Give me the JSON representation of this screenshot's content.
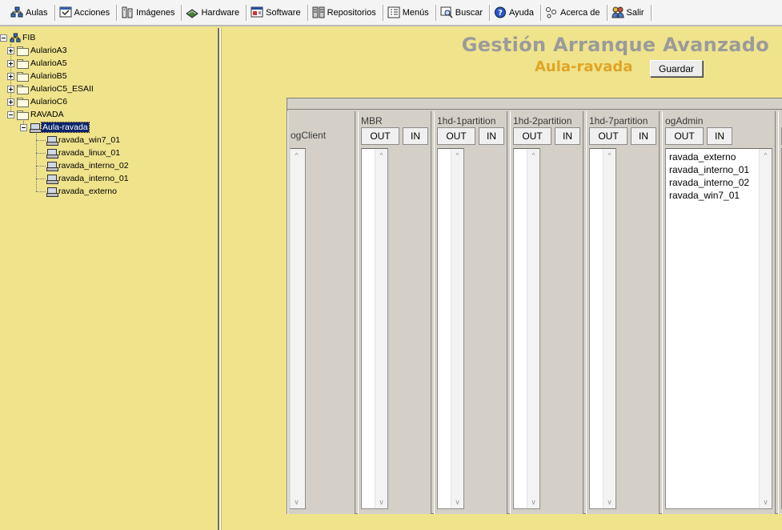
{
  "toolbar": {
    "items": [
      {
        "label": "Aulas",
        "icon": "network-icon"
      },
      {
        "label": "Acciones",
        "icon": "actions-icon"
      },
      {
        "label": "Imágenes",
        "icon": "images-icon"
      },
      {
        "label": "Hardware",
        "icon": "hardware-icon"
      },
      {
        "label": "Software",
        "icon": "software-icon"
      },
      {
        "label": "Repositorios",
        "icon": "repository-icon"
      },
      {
        "label": "Menús",
        "icon": "menu-icon"
      },
      {
        "label": "Buscar",
        "icon": "search-icon"
      },
      {
        "label": "Ayuda",
        "icon": "help-icon"
      },
      {
        "label": "Acerca de",
        "icon": "about-icon"
      },
      {
        "label": "Salir",
        "icon": "exit-icon"
      }
    ]
  },
  "tree": {
    "root": "FIB",
    "groups": [
      "AularioA3",
      "AularioA5",
      "AularioB5",
      "AularioC5_ESAII",
      "AularioC6",
      "RAVADA"
    ],
    "selected_aula": "Aula-ravada",
    "computers": [
      "ravada_win7_01",
      "ravada_linux_01",
      "ravada_interno_02",
      "ravada_interno_01",
      "ravada_externo"
    ]
  },
  "main": {
    "title": "Gestión Arranque Avanzado",
    "subtitle": "Aula-ravada",
    "save_label": "Guardar"
  },
  "columns": {
    "ogclient": {
      "title": "ogClient"
    },
    "mbr": {
      "title": "MBR",
      "out": "OUT",
      "in": "IN"
    },
    "p1": {
      "title": "1hd-1partition",
      "out": "OUT",
      "in": "IN"
    },
    "p2": {
      "title": "1hd-2partition",
      "out": "OUT",
      "in": "IN"
    },
    "p7": {
      "title": "1hd-7partition",
      "out": "OUT",
      "in": "IN"
    },
    "ogadmin": {
      "title": "ogAdmin",
      "out": "OUT",
      "in": "IN",
      "items": [
        "ravada_externo",
        "ravada_interno_01",
        "ravada_interno_02",
        "ravada_win7_01"
      ]
    }
  }
}
